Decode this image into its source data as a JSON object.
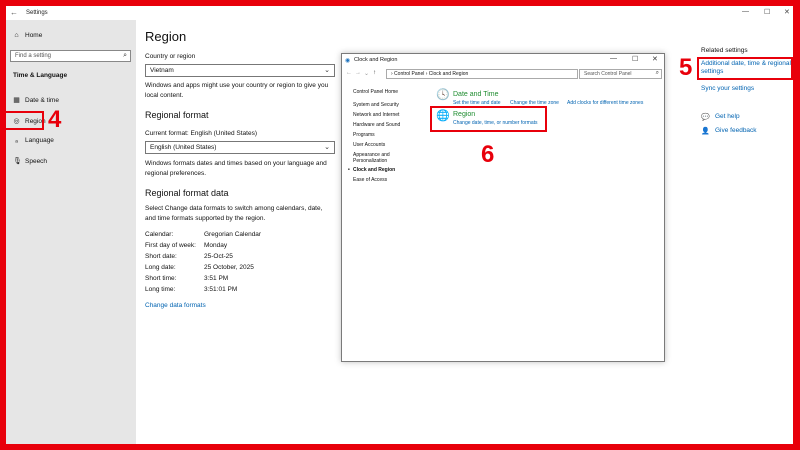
{
  "window": {
    "title": "Settings",
    "back_glyph": "←",
    "minimize": "—",
    "maximize": "☐",
    "close": "✕"
  },
  "sidebar": {
    "home": "Home",
    "search_placeholder": "Find a setting",
    "section": "Time & Language",
    "items": [
      {
        "label": "Date & time",
        "icon": "calendar-icon"
      },
      {
        "label": "Region",
        "icon": "globe-icon"
      },
      {
        "label": "Language",
        "icon": "language-icon"
      },
      {
        "label": "Speech",
        "icon": "microphone-icon"
      }
    ]
  },
  "main": {
    "title": "Region",
    "country_label": "Country or region",
    "country_value": "Vietnam",
    "country_desc": "Windows and apps might use your country or region to give you local content.",
    "format_heading": "Regional format",
    "current_format": "Current format: English (United States)",
    "format_value": "English (United States)",
    "format_desc": "Windows formats dates and times based on your language and regional preferences.",
    "data_heading": "Regional format data",
    "data_desc": "Select Change data formats to switch among calendars, date, and time formats supported by the region.",
    "rows": [
      {
        "key": "Calendar:",
        "value": "Gregorian Calendar"
      },
      {
        "key": "First day of week:",
        "value": "Monday"
      },
      {
        "key": "Short date:",
        "value": "25-Oct-25"
      },
      {
        "key": "Long date:",
        "value": "25 October, 2025"
      },
      {
        "key": "Short time:",
        "value": "3:51 PM"
      },
      {
        "key": "Long time:",
        "value": "3:51:01 PM"
      }
    ],
    "change_link": "Change data formats"
  },
  "control_panel": {
    "title": "Clock and Region",
    "breadcrumb": "› Control Panel › Clock and Region",
    "search_placeholder": "Search Control Panel",
    "left_nav": [
      "Control Panel Home",
      "System and Security",
      "Network and Internet",
      "Hardware and Sound",
      "Programs",
      "User Accounts",
      "Appearance and",
      "Personalization",
      "Clock and Region",
      "Ease of Access"
    ],
    "date_time": {
      "title": "Date and Time",
      "links": [
        "Set the time and date",
        "Change the time zone",
        "Add clocks for different time zones"
      ]
    },
    "region": {
      "title": "Region",
      "link": "Change date, time, or number formats"
    }
  },
  "related": {
    "heading": "Related settings",
    "link1": "Additional date, time & regional",
    "link1b": "settings",
    "sync": "Sync your settings",
    "help": "Get help",
    "feedback": "Give feedback"
  },
  "annotations": {
    "step4": "4",
    "step5": "5",
    "step6": "6"
  },
  "colors": {
    "accent_red": "#e8000b",
    "link_blue": "#0063b1",
    "cp_green": "#1e8c2f",
    "sidebar_bg": "#e6e6e6"
  }
}
